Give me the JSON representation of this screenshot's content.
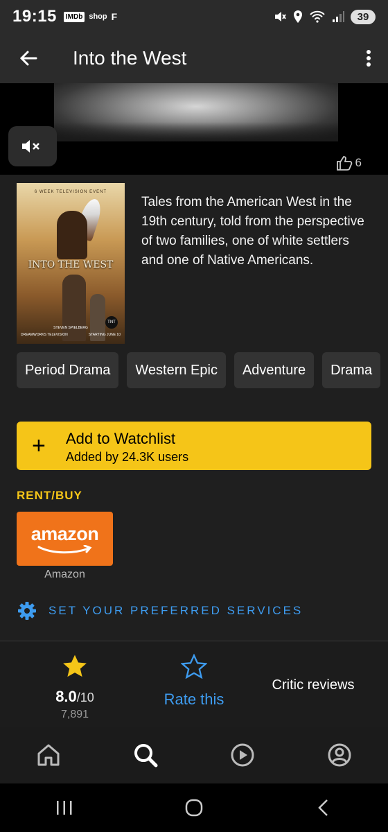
{
  "status_bar": {
    "time": "19:15",
    "notif_imdb": "IMDb",
    "notif_shop": "shop",
    "notif_f": "F",
    "battery": "39"
  },
  "app_bar": {
    "title": "Into the West"
  },
  "video": {
    "likes": "6"
  },
  "poster": {
    "top_line": "6 WEEK TELEVISION EVENT",
    "title": "INTO THE WEST",
    "spielberg": "STEVEN SPIELBERG",
    "dreamworks": "DREAMWORKS TELEVISION",
    "network": "TNT",
    "date": "STARTING JUNE 10"
  },
  "plot": "Tales from the American West in the 19th century, told from the perspective of two families, one of white settlers and one of Native Americans.",
  "genres": [
    "Period Drama",
    "Western Epic",
    "Adventure",
    "Drama"
  ],
  "watchlist": {
    "icon": "+",
    "title": "Add to Watchlist",
    "subtitle": "Added by 24.3K users"
  },
  "rent_buy": {
    "label": "RENT/BUY",
    "provider_logo_text": "amazon",
    "provider_name": "Amazon"
  },
  "preferred_services": {
    "label": "SET YOUR PREFERRED SERVICES"
  },
  "ratings": {
    "score": "8.0",
    "scale": "/10",
    "votes": "7,891",
    "rate_label": "Rate this",
    "critic_label": "Critic reviews"
  },
  "bottom_nav": [
    "home-icon",
    "search-icon",
    "video-icon",
    "profile-icon"
  ],
  "colors": {
    "imdb_yellow": "#f5c518",
    "link_blue": "#3e9cf0",
    "amazon_orange": "#f0731a"
  }
}
